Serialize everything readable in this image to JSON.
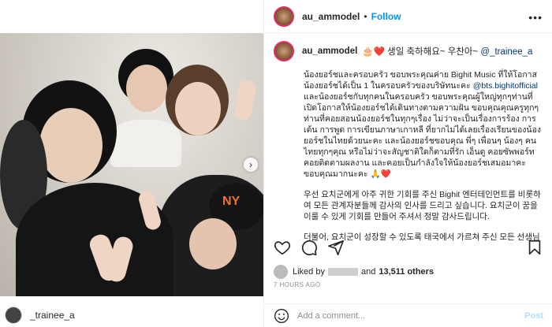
{
  "post": {
    "author": "au_ammodel",
    "follow_label": "Follow",
    "dot": "•",
    "more": "•••"
  },
  "caption": {
    "username": "au_ammodel",
    "first_line_emoji": "🎂❤️ 생일 축하해요~ 우찬아~ ",
    "first_line_mention": "@_trainee_a",
    "thai_part1": "น้องยอร์ชและครอบครัว ขอบพระคุณค่าย Bighit Music ที่ให้โอกาสน้องยอร์ชได้เป็น 1 ในครอบครัวของบริษัทนะคะ ",
    "thai_mention": "@bts.bighitofficial",
    "thai_part2": " และน้องยอร์ชกับทุกคนในครอบครัว ขอบพระคุณผู้ใหญ่ทุกๆท่านที่เปิดโอกาสให้น้องยอร์ชได้เดินทางตามความฝัน ขอบคุณคุณครูทุกๆท่านที่คอยสอนน้องยอร์ชในทุกๆเรื่อง ไม่ว่าจะเป็นเรื่องการร้อง การเต้น การพูด การเขียนภาษาเกาหลี ที่ยากไม่ได้เลยเรื่องเรียนของน้องยอร์ชในไทยด้วยนะคะ และน้องยอร์ชขอบคุณ พี่ๆ เพื่อนๆ น้องๆ คนไทยทุกๆคุณ หรือไม่ว่าจะสัญชาติใดก็ตามที่รัก เอ็นดู คอยซัพพอร์ท คอยติดตามผลงาน และคอยเป็นกำลังใจให้น้องยอร์ชเสมอมาคะ ขอบคุณมากนะคะ 🙏❤️",
    "korean_1": "우선 요치군에게 아주 귀한 기회를 주신 Bighit 엔터테인먼트를 비롯하여 모든 관계자분들께 감사의 인사를 드리고 싶습니다. 요치군이 꿈을 이룰 수 있게 기회를 만들어 주셔서 정말 감사드립니다.",
    "korean_2": "더불어, 요치군이 성장할 수 있도록 태국에서 가르쳐 주신 모든 선생님"
  },
  "likes": {
    "prefix": "Liked by",
    "and_text": "and",
    "others": "13,511 others"
  },
  "timestamp": "7 HOURS AGO",
  "comment": {
    "placeholder": "Add a comment...",
    "post_label": "Post"
  },
  "tagged": {
    "username": "_trainee_a"
  },
  "photo": {
    "cap_logo": "NY"
  },
  "icons": [
    "heart-icon",
    "comment-icon",
    "share-icon",
    "save-icon",
    "emoji-icon",
    "next-arrow-icon"
  ],
  "colors": {
    "accent": "#0095f6",
    "mention": "#00376b",
    "muted": "#8e8e8e",
    "post_disabled": "#b2dffc"
  }
}
